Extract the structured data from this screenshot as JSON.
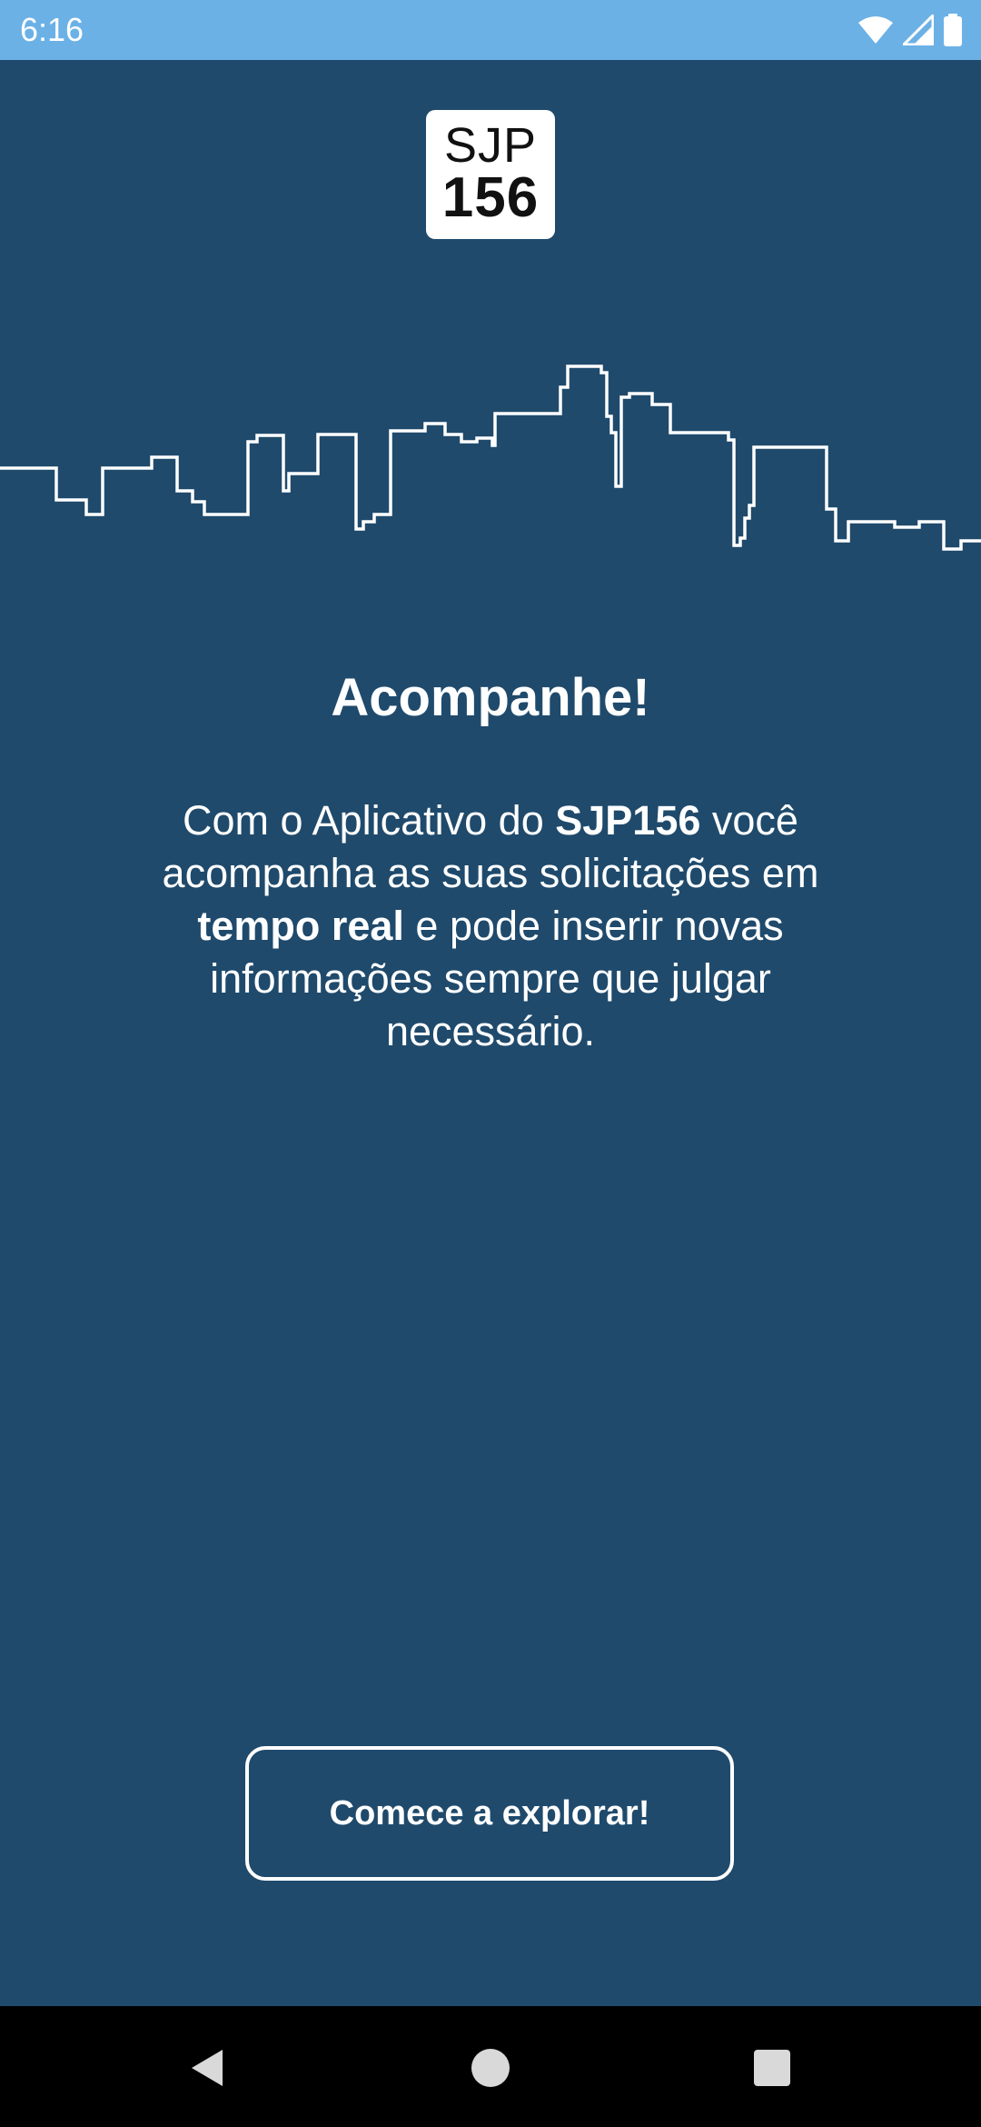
{
  "status_bar": {
    "time": "6:16",
    "icons": [
      "wifi-icon",
      "signal-icon",
      "battery-icon"
    ]
  },
  "logo": {
    "line1": "SJP",
    "line2": "156"
  },
  "onboarding": {
    "title": "Acompanhe!",
    "description": {
      "part1": "Com o Aplicativo do ",
      "bold1": "SJP156",
      "part2": " você acompanha as suas solicitações em ",
      "bold2": "tempo real",
      "part3": " e pode inserir novas informações sempre que julgar necessário."
    },
    "cta_label": "Comece a explorar!"
  },
  "nav_bar": {
    "icons": [
      "back-icon",
      "home-icon",
      "recents-icon"
    ]
  },
  "colors": {
    "background": "#1f4a6c",
    "status_bar": "#6bb1e6",
    "foreground": "#ffffff"
  }
}
